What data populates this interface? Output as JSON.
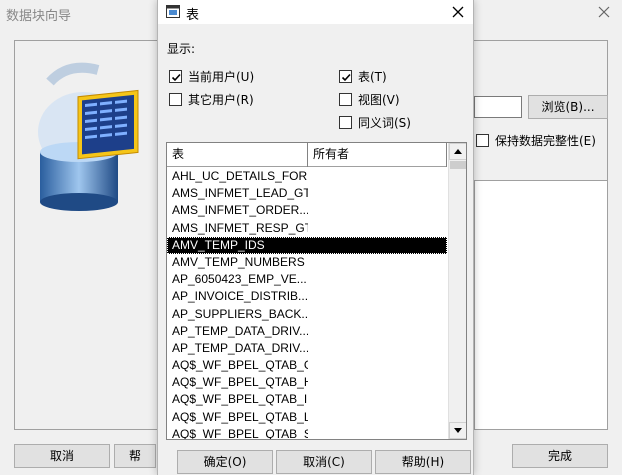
{
  "background_window": {
    "title": "数据块向导",
    "browse_label": "浏览(B)...",
    "keep_integrity_label": "保持数据完整性(E)",
    "cancel_label": "取消",
    "help_label_partial": "帮",
    "finish_label": "完成"
  },
  "dialog": {
    "title": "表",
    "display_label": "显示:",
    "options": {
      "current_user": {
        "label": "当前用户(U)",
        "checked": true
      },
      "other_users": {
        "label": "其它用户(R)",
        "checked": false
      },
      "tables": {
        "label": "表(T)",
        "checked": true
      },
      "views": {
        "label": "视图(V)",
        "checked": false
      },
      "synonyms": {
        "label": "同义词(S)",
        "checked": false
      }
    },
    "columns": {
      "table": "表",
      "owner": "所有者"
    },
    "rows": [
      "AHL_UC_DETAILS_FOR...",
      "AMS_INFMET_LEAD_GT",
      "AMS_INFMET_ORDER...",
      "AMS_INFMET_RESP_GT",
      "AMV_TEMP_IDS",
      "AMV_TEMP_NUMBERS",
      "AP_6050423_EMP_VE...",
      "AP_INVOICE_DISTRIB...",
      "AP_SUPPLIERS_BACK...",
      "AP_TEMP_DATA_DRIV...",
      "AP_TEMP_DATA_DRIV...",
      "AQ$_WF_BPEL_QTAB_G",
      "AQ$_WF_BPEL_QTAB_H",
      "AQ$_WF_BPEL_QTAB_I",
      "AQ$_WF_BPEL_QTAB_L",
      "AQ$_WF_BPEL_QTAB_S"
    ],
    "selected_row": "AMV_TEMP_IDS",
    "ok_label": "确定(O)",
    "cancel_label": "取消(C)",
    "help_label": "帮助(H)"
  }
}
